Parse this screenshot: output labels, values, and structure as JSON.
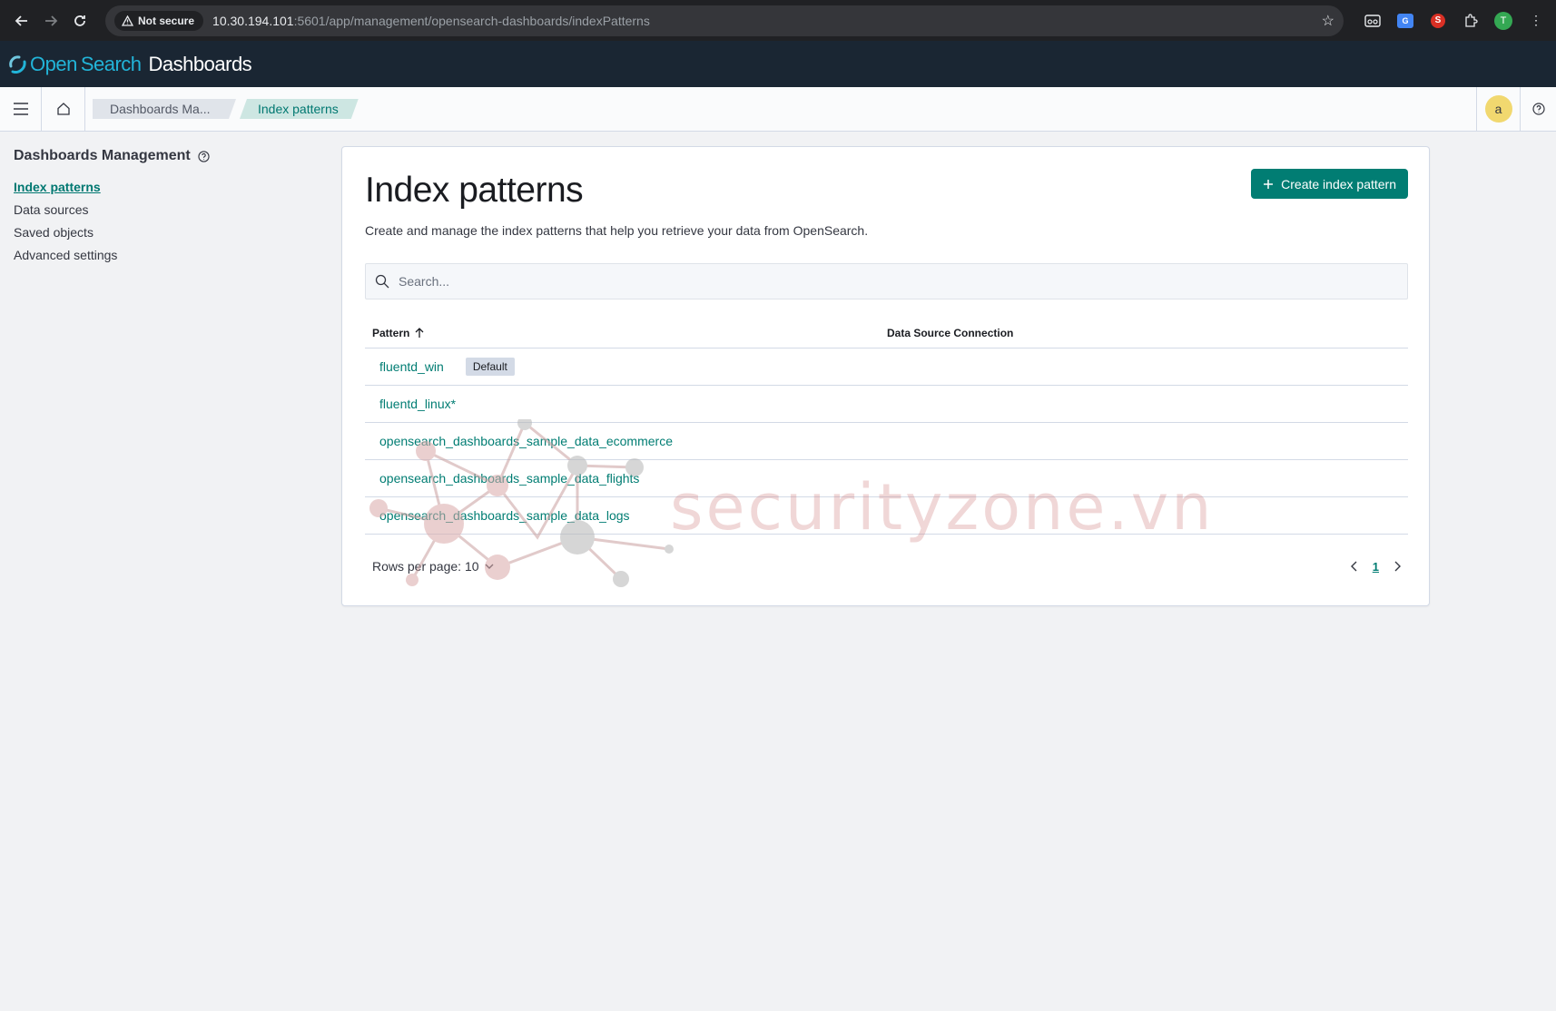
{
  "browser": {
    "not_secure_label": "Not secure",
    "url_host": "10.30.194.101",
    "url_rest": ":5601/app/management/opensearch-dashboards/indexPatterns",
    "profile_initial": "T",
    "ext_s_label": "S",
    "ext_translate_label": "G"
  },
  "app": {
    "logo_open": "Open",
    "logo_search": "Search",
    "logo_dashboards": "Dashboards",
    "accent": "#017d73"
  },
  "breadcrumbs": [
    {
      "label": "Dashboards Ma..."
    },
    {
      "label": "Index patterns"
    }
  ],
  "user": {
    "avatar_initial": "a"
  },
  "sidebar": {
    "title": "Dashboards Management",
    "items": [
      {
        "label": "Index patterns",
        "active": true
      },
      {
        "label": "Data sources"
      },
      {
        "label": "Saved objects"
      },
      {
        "label": "Advanced settings"
      }
    ]
  },
  "main": {
    "title": "Index patterns",
    "description": "Create and manage the index patterns that help you retrieve your data from OpenSearch.",
    "create_button": "Create index pattern",
    "search_placeholder": "Search...",
    "columns": {
      "pattern": "Pattern",
      "data_source": "Data Source Connection"
    },
    "rows": [
      {
        "pattern": "fluentd_win",
        "tag": "Default"
      },
      {
        "pattern": "fluentd_linux*"
      },
      {
        "pattern": "opensearch_dashboards_sample_data_ecommerce"
      },
      {
        "pattern": "opensearch_dashboards_sample_data_flights"
      },
      {
        "pattern": "opensearch_dashboards_sample_data_logs"
      }
    ],
    "rows_per_page": "Rows per page: 10",
    "current_page": "1"
  },
  "watermark": {
    "text": "securityzone.vn"
  }
}
